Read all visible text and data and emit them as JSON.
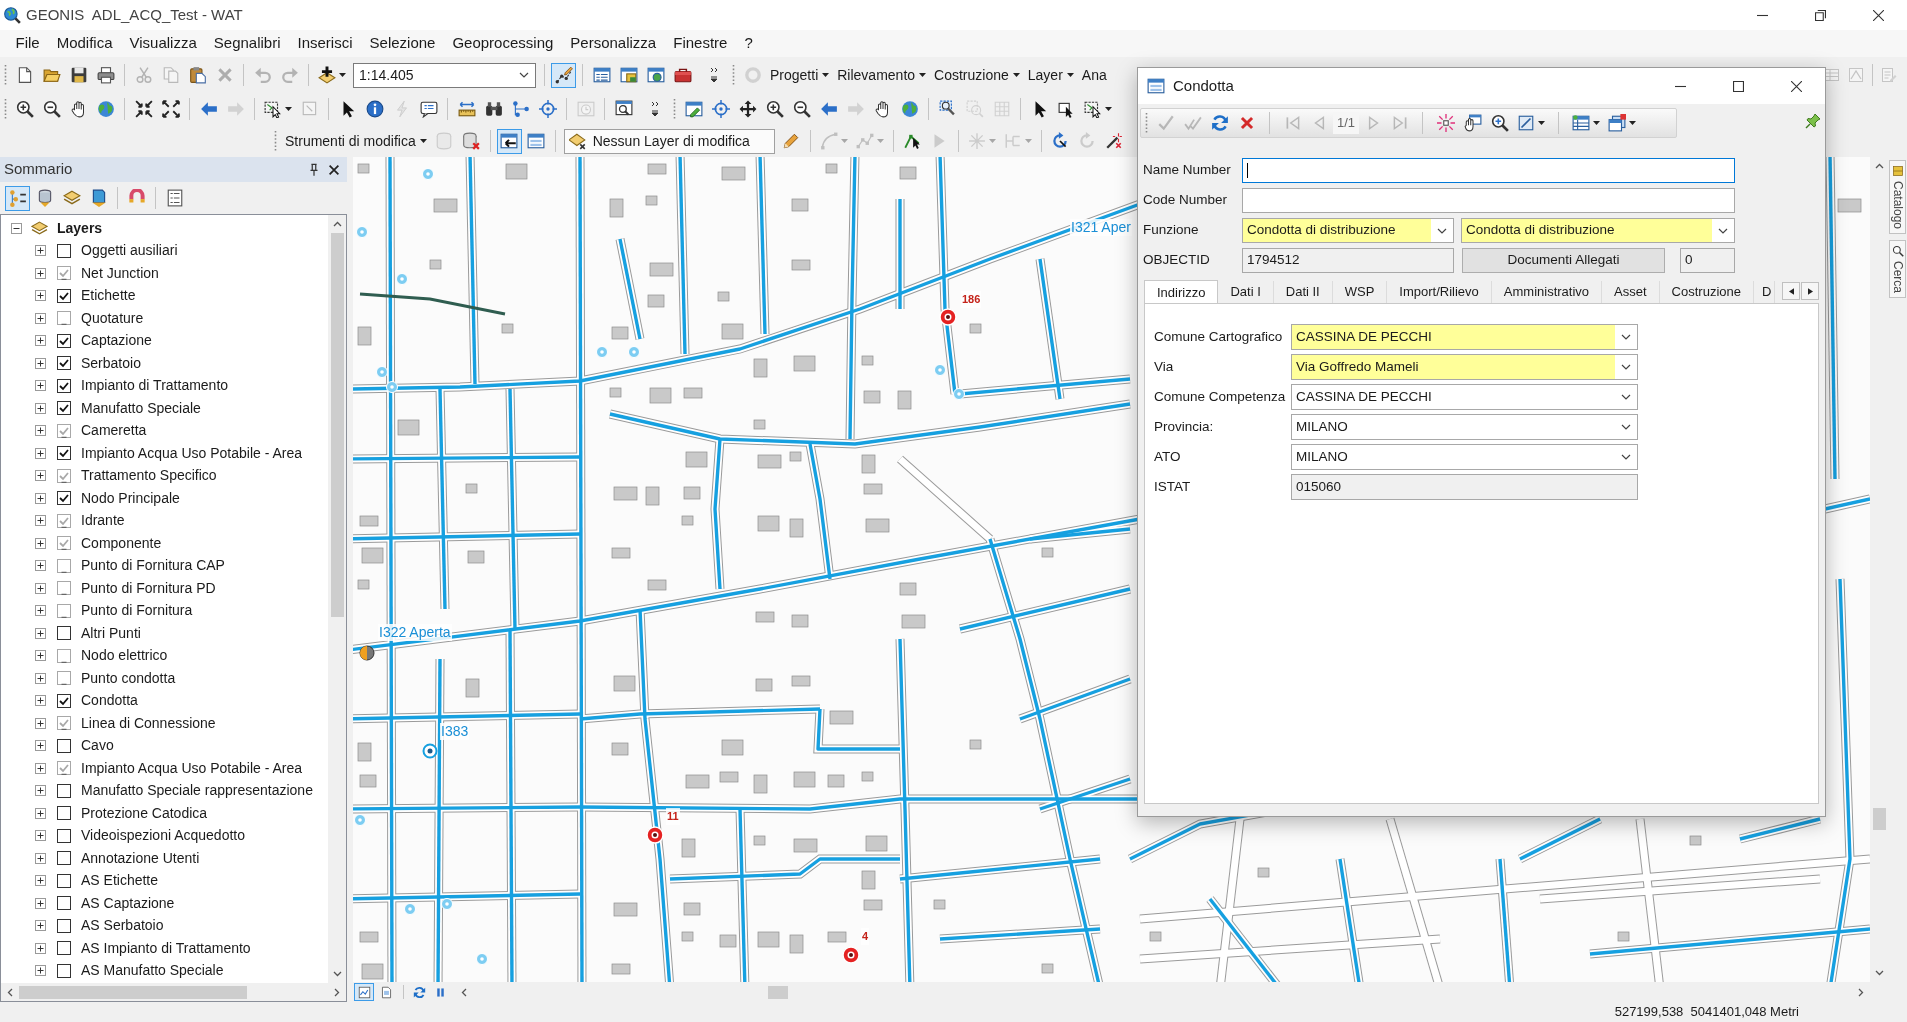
{
  "window": {
    "title": "GEONIS  ADL_ACQ_Test - WAT"
  },
  "menu_bar": [
    "File",
    "Modifica",
    "Visualizza",
    "Segnalibri",
    "Inserisci",
    "Selezione",
    "Geoprocessing",
    "Personalizza",
    "Finestre",
    "?"
  ],
  "toolbars": [
    {
      "items": [
        {
          "kind": "grip"
        },
        {
          "kind": "button",
          "disabled": false
        },
        {
          "kind": "button",
          "disabled": false
        },
        {
          "kind": "button",
          "disabled": false
        },
        {
          "kind": "button",
          "disabled": false
        },
        {
          "kind": "separator"
        },
        {
          "kind": "button",
          "disabled": true
        },
        {
          "kind": "button",
          "disabled": true
        },
        {
          "kind": "button",
          "disabled": false
        },
        {
          "kind": "button",
          "disabled": true
        },
        {
          "kind": "separator"
        },
        {
          "kind": "button",
          "disabled": true
        },
        {
          "kind": "button",
          "disabled": true
        },
        {
          "kind": "separator"
        },
        {
          "kind": "dropdown",
          "disabled": false
        },
        {
          "kind": "combo",
          "value": "1:14.405"
        },
        {
          "kind": "separator"
        },
        {
          "kind": "toggle",
          "pressed": true
        },
        {
          "kind": "separator"
        },
        {
          "kind": "button",
          "disabled": false
        },
        {
          "kind": "button",
          "disabled": false
        },
        {
          "kind": "button",
          "disabled": false
        },
        {
          "kind": "button",
          "disabled": false
        },
        {
          "kind": "overflow"
        },
        {
          "kind": "grip"
        },
        {
          "kind": "button",
          "disabled": true
        },
        {
          "kind": "menu",
          "label": "Progetti"
        },
        {
          "kind": "menu",
          "label": "Rilevamento"
        },
        {
          "kind": "menu",
          "label": "Costruzione"
        },
        {
          "kind": "menu",
          "label": "Layer"
        },
        {
          "kind": "partial",
          "label": "Ana"
        }
      ],
      "end_items": [
        {
          "kind": "button",
          "disabled": true
        },
        {
          "kind": "button",
          "disabled": true
        },
        {
          "kind": "separator"
        },
        {
          "kind": "button",
          "disabled": true
        }
      ]
    },
    {
      "items": [
        {
          "kind": "grip"
        },
        {
          "kind": "button",
          "disabled": false
        },
        {
          "kind": "button",
          "disabled": false
        },
        {
          "kind": "button",
          "disabled": false
        },
        {
          "kind": "button",
          "disabled": false
        },
        {
          "kind": "separator"
        },
        {
          "kind": "button",
          "disabled": false
        },
        {
          "kind": "button",
          "disabled": false
        },
        {
          "kind": "separator"
        },
        {
          "kind": "button",
          "disabled": false
        },
        {
          "kind": "button",
          "disabled": true
        },
        {
          "kind": "separator"
        },
        {
          "kind": "dropdown",
          "disabled": false
        },
        {
          "kind": "button",
          "disabled": true
        },
        {
          "kind": "separator"
        },
        {
          "kind": "button",
          "disabled": false
        },
        {
          "kind": "button",
          "disabled": false
        },
        {
          "kind": "button",
          "disabled": true
        },
        {
          "kind": "button",
          "disabled": false
        },
        {
          "kind": "separator"
        },
        {
          "kind": "button",
          "disabled": false
        },
        {
          "kind": "button",
          "disabled": false
        },
        {
          "kind": "button",
          "disabled": false
        },
        {
          "kind": "button",
          "disabled": false
        },
        {
          "kind": "separator"
        },
        {
          "kind": "button",
          "disabled": true
        },
        {
          "kind": "separator"
        },
        {
          "kind": "button",
          "disabled": false
        },
        {
          "kind": "overflow"
        },
        {
          "kind": "grip"
        },
        {
          "kind": "button",
          "disabled": false
        },
        {
          "kind": "button",
          "disabled": false
        },
        {
          "kind": "button",
          "disabled": false
        },
        {
          "kind": "button",
          "disabled": false
        },
        {
          "kind": "button",
          "disabled": false
        },
        {
          "kind": "button",
          "disabled": false
        },
        {
          "kind": "button",
          "disabled": true
        },
        {
          "kind": "button",
          "disabled": false
        },
        {
          "kind": "button",
          "disabled": false
        },
        {
          "kind": "separator"
        },
        {
          "kind": "button",
          "disabled": false
        },
        {
          "kind": "button",
          "disabled": true
        },
        {
          "kind": "button",
          "disabled": true
        },
        {
          "kind": "separator"
        },
        {
          "kind": "button",
          "disabled": false
        },
        {
          "kind": "button",
          "disabled": false
        },
        {
          "kind": "dropdown",
          "disabled": false
        }
      ]
    },
    {
      "items": [
        {
          "kind": "grip"
        },
        {
          "kind": "menu",
          "label": "Strumenti di modifica"
        },
        {
          "kind": "button",
          "disabled": true
        },
        {
          "kind": "button",
          "disabled": false
        },
        {
          "kind": "separator"
        },
        {
          "kind": "toggle",
          "pressed": true
        },
        {
          "kind": "button",
          "disabled": false
        },
        {
          "kind": "separator"
        },
        {
          "kind": "layer",
          "label": "Nessun Layer di modifica"
        },
        {
          "kind": "button",
          "disabled": false
        },
        {
          "kind": "separator"
        },
        {
          "kind": "dropdown",
          "disabled": true
        },
        {
          "kind": "dropdown",
          "disabled": true
        },
        {
          "kind": "separator"
        },
        {
          "kind": "button",
          "disabled": false
        },
        {
          "kind": "button",
          "disabled": true
        },
        {
          "kind": "separator"
        },
        {
          "kind": "dropdown",
          "disabled": true
        },
        {
          "kind": "dropdown",
          "disabled": true
        },
        {
          "kind": "separator"
        },
        {
          "kind": "button",
          "disabled": false
        },
        {
          "kind": "button",
          "disabled": true
        },
        {
          "kind": "button",
          "disabled": false
        }
      ]
    }
  ],
  "sidebar": {
    "title": "Sommario",
    "tools": [
      {
        "kind": "tab",
        "selected": true
      },
      {
        "kind": "tab",
        "selected": false
      },
      {
        "kind": "tab",
        "selected": false
      },
      {
        "kind": "tab",
        "selected": false
      },
      {
        "kind": "separator"
      },
      {
        "kind": "button",
        "disabled": false
      },
      {
        "kind": "separator"
      },
      {
        "kind": "button",
        "disabled": false
      }
    ],
    "tree": {
      "label": "Layers",
      "expanded": true,
      "children": [
        {
          "label": "Oggetti ausiliari",
          "checked": false,
          "dimmed": false,
          "expanded": false
        },
        {
          "label": "Net Junction",
          "checked": true,
          "dimmed": true,
          "expanded": false
        },
        {
          "label": "Etichette",
          "checked": true,
          "dimmed": false,
          "expanded": false
        },
        {
          "label": "Quotature",
          "checked": false,
          "dimmed": true,
          "expanded": false
        },
        {
          "label": "Captazione",
          "checked": true,
          "dimmed": false,
          "expanded": false
        },
        {
          "label": "Serbatoio",
          "checked": true,
          "dimmed": false,
          "expanded": false
        },
        {
          "label": "Impianto di Trattamento",
          "checked": true,
          "dimmed": false,
          "expanded": false
        },
        {
          "label": "Manufatto Speciale",
          "checked": true,
          "dimmed": false,
          "expanded": false
        },
        {
          "label": "Cameretta",
          "checked": true,
          "dimmed": true,
          "expanded": false
        },
        {
          "label": "Impianto Acqua Uso Potabile - Area",
          "checked": true,
          "dimmed": false,
          "expanded": false
        },
        {
          "label": "Trattamento Specifico",
          "checked": true,
          "dimmed": true,
          "expanded": false
        },
        {
          "label": "Nodo Principale",
          "checked": true,
          "dimmed": false,
          "expanded": false
        },
        {
          "label": "Idrante",
          "checked": true,
          "dimmed": true,
          "expanded": false
        },
        {
          "label": "Componente",
          "checked": true,
          "dimmed": true,
          "expanded": false
        },
        {
          "label": "Punto di Fornitura CAP",
          "checked": false,
          "dimmed": true,
          "expanded": false
        },
        {
          "label": "Punto di Fornitura PD",
          "checked": false,
          "dimmed": true,
          "expanded": false
        },
        {
          "label": "Punto di Fornitura",
          "checked": false,
          "dimmed": true,
          "expanded": false
        },
        {
          "label": "Altri Punti",
          "checked": false,
          "dimmed": false,
          "expanded": false
        },
        {
          "label": "Nodo elettrico",
          "checked": false,
          "dimmed": true,
          "expanded": false
        },
        {
          "label": "Punto condotta",
          "checked": false,
          "dimmed": true,
          "expanded": false
        },
        {
          "label": "Condotta",
          "checked": true,
          "dimmed": false,
          "expanded": false
        },
        {
          "label": "Linea di Connessione",
          "checked": true,
          "dimmed": true,
          "expanded": false
        },
        {
          "label": "Cavo",
          "checked": false,
          "dimmed": false,
          "expanded": false
        },
        {
          "label": "Impianto Acqua Uso Potabile - Area",
          "checked": true,
          "dimmed": true,
          "expanded": false
        },
        {
          "label": "Manufatto Speciale rappresentazione",
          "checked": false,
          "dimmed": false,
          "expanded": false
        },
        {
          "label": "Protezione Catodica",
          "checked": false,
          "dimmed": false,
          "expanded": false
        },
        {
          "label": "Videoispezioni Acquedotto",
          "checked": false,
          "dimmed": false,
          "expanded": false
        },
        {
          "label": "Annotazione Utenti",
          "checked": false,
          "dimmed": false,
          "expanded": false
        },
        {
          "label": "AS Etichette",
          "checked": false,
          "dimmed": false,
          "expanded": false
        },
        {
          "label": "AS Captazione",
          "checked": false,
          "dimmed": false,
          "expanded": false
        },
        {
          "label": "AS Serbatoio",
          "checked": false,
          "dimmed": false,
          "expanded": false
        },
        {
          "label": "AS Impianto di Trattamento",
          "checked": false,
          "dimmed": false,
          "expanded": false
        },
        {
          "label": "AS Manufatto Speciale",
          "checked": false,
          "dimmed": false,
          "expanded": false
        }
      ]
    }
  },
  "map": {
    "labels": [
      "I321 Aper",
      "I322 Aperta",
      "I383"
    ],
    "markers": [
      {
        "kind": "valve"
      },
      {
        "kind": "valve"
      },
      {
        "kind": "valve"
      },
      {
        "kind": "valve"
      },
      {
        "kind": "valve"
      },
      {
        "kind": "valve"
      },
      {
        "kind": "valve"
      },
      {
        "kind": "valve"
      },
      {
        "kind": "valve"
      },
      {
        "kind": "valve"
      },
      {
        "kind": "valve"
      },
      {
        "kind": "valve"
      },
      {
        "kind": "valve"
      },
      {
        "kind": "target",
        "label": "186"
      },
      {
        "kind": "target",
        "label": "11"
      },
      {
        "kind": "target",
        "label": "4"
      },
      {
        "kind": "half"
      },
      {
        "kind": "ring"
      }
    ],
    "views": [
      {
        "selected": true
      },
      {
        "selected": false
      }
    ]
  },
  "side_panel": {
    "tabs": [
      {
        "label": "Catalogo"
      },
      {
        "label": "Cerca"
      }
    ]
  },
  "dialog": {
    "title": "Condotta",
    "toolbar": [
      {
        "kind": "button",
        "disabled": true
      },
      {
        "kind": "button",
        "disabled": true
      },
      {
        "kind": "button",
        "disabled": false
      },
      {
        "kind": "button",
        "disabled": false
      },
      {
        "kind": "separator"
      },
      {
        "kind": "button",
        "disabled": true
      },
      {
        "kind": "button",
        "disabled": true
      },
      {
        "kind": "counter",
        "text": "1/1"
      },
      {
        "kind": "button",
        "disabled": true
      },
      {
        "kind": "button",
        "disabled": true
      },
      {
        "kind": "separator"
      },
      {
        "kind": "button",
        "disabled": false
      },
      {
        "kind": "button",
        "disabled": false
      },
      {
        "kind": "button",
        "disabled": false
      },
      {
        "kind": "dropdown",
        "disabled": false
      },
      {
        "kind": "separator"
      },
      {
        "kind": "dropdown",
        "disabled": false
      },
      {
        "kind": "dropdown",
        "disabled": false
      }
    ],
    "form": [
      {
        "kind": "text",
        "label": "Name Number",
        "focused": true
      },
      {
        "kind": "text",
        "label": "Code Number",
        "focused": false
      },
      {
        "kind": "combos",
        "label": "Funzione",
        "values": [
          {
            "value": "Condotta di distribuzione",
            "required": true
          },
          {
            "value": "Condotta di distribuzione",
            "required": true
          }
        ]
      },
      {
        "kind": "id",
        "label": "OBJECTID",
        "value": "1794512",
        "button": "Documenti Allegati",
        "count": "0"
      }
    ],
    "tabs": [
      {
        "label": "Indirizzo",
        "selected": true
      },
      {
        "label": "Dati I",
        "selected": false
      },
      {
        "label": "Dati II",
        "selected": false
      },
      {
        "label": "WSP",
        "selected": false
      },
      {
        "label": "Import/Rilievo",
        "selected": false
      },
      {
        "label": "Amministrativo",
        "selected": false
      },
      {
        "label": "Asset",
        "selected": false
      },
      {
        "label": "Costruzione",
        "selected": false
      },
      {
        "label": "D",
        "selected": false
      }
    ],
    "fields": [
      {
        "kind": "combo",
        "label": "Comune Cartografico",
        "value": "CASSINA DE PECCHI",
        "required": true
      },
      {
        "kind": "combo",
        "label": "Via",
        "value": "Via Goffredo Mameli",
        "required": true
      },
      {
        "kind": "combo",
        "label": "Comune Competenza",
        "value": "CASSINA DE PECCHI",
        "required": false
      },
      {
        "kind": "combo",
        "label": "Provincia:",
        "value": "MILANO",
        "required": false
      },
      {
        "kind": "combo",
        "label": "ATO",
        "value": "MILANO",
        "required": false
      },
      {
        "kind": "readonly",
        "label": "ISTAT",
        "value": "015060"
      }
    ]
  },
  "status_bar": {
    "coordinates": "527199,538  5041401,048 Metri"
  }
}
